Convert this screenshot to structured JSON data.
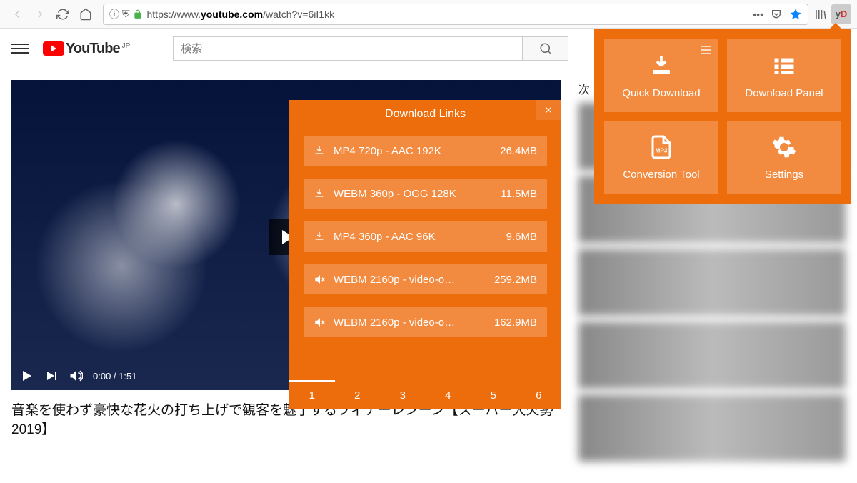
{
  "browser": {
    "url_prefix": "https://www.",
    "url_host": "youtube.com",
    "url_path": "/watch?v=6iI1kk",
    "ext_label": "yD"
  },
  "youtube": {
    "brand": "YouTube",
    "region": "JP",
    "search_placeholder": "検索",
    "video_time": "0:00 / 1:51",
    "video_title": "音楽を使わず豪快な花火の打ち上げで観客を魅了するフィナーレシーン【スーパー大火勢2019】",
    "sidebar_heading": "次"
  },
  "download_panel": {
    "title": "Download Links",
    "items": [
      {
        "icon": "download",
        "label": "MP4 720p - AAC 192K",
        "size": "26.4MB"
      },
      {
        "icon": "download",
        "label": "WEBM 360p - OGG 128K",
        "size": "11.5MB"
      },
      {
        "icon": "download",
        "label": "MP4 360p - AAC 96K",
        "size": "9.6MB"
      },
      {
        "icon": "muted",
        "label": "WEBM 2160p - video-o…",
        "size": "259.2MB"
      },
      {
        "icon": "muted",
        "label": "WEBM 2160p - video-o…",
        "size": "162.9MB"
      }
    ],
    "pages": [
      "1",
      "2",
      "3",
      "4",
      "5",
      "6"
    ],
    "active_page": 0
  },
  "ext_popup": {
    "tiles": [
      {
        "label": "Quick Download",
        "icon": "download-tray",
        "has_menu": true
      },
      {
        "label": "Download Panel",
        "icon": "list"
      },
      {
        "label": "Conversion Tool",
        "icon": "mp3-file"
      },
      {
        "label": "Settings",
        "icon": "gear"
      }
    ]
  },
  "colors": {
    "accent": "#ed6c0c",
    "accent_light": "#f28a3f"
  }
}
